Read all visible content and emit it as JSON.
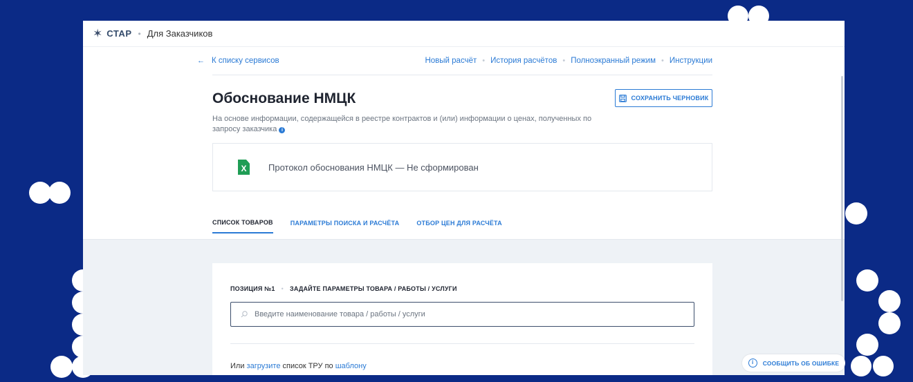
{
  "header": {
    "brand": "СТАР",
    "section": "Для Заказчиков"
  },
  "subnav": {
    "back": "К списку сервисов",
    "links": [
      "Новый расчёт",
      "История расчётов",
      "Полноэкранный режим",
      "Инструкции"
    ]
  },
  "page": {
    "title": "Обоснование НМЦК",
    "save_draft": "СОХРАНИТЬ ЧЕРНОВИК",
    "description": "На основе информации, содержащейся в реестре контрактов и (или) информации о ценах, полученных по запросу заказчика"
  },
  "protocol": {
    "text": "Протокол обоснования НМЦК — Не сформирован",
    "icon_letter": "X"
  },
  "tabs": [
    "СПИСОК ТОВАРОВ",
    "ПАРАМЕТРЫ ПОИСКА И РАСЧЁТА",
    "ОТБОР ЦЕН ДЛЯ РАСЧЁТА"
  ],
  "form": {
    "position": "ПОЗИЦИЯ №1",
    "params": "ЗАДАЙТЕ ПАРАМЕТРЫ ТОВАРА / РАБОТЫ / УСЛУГИ",
    "search_placeholder": "Введите наименование товара / работы / услуги",
    "upload_prefix": "Или",
    "upload_link": "загрузите",
    "upload_middle": "список ТРУ по",
    "template_link": "шаблону"
  },
  "report_button": "СООБЩИТЬ ОБ ОШИБКЕ",
  "colors": {
    "background": "#0b2a86",
    "accent": "#2a7ad5",
    "excel": "#1f9d55"
  }
}
